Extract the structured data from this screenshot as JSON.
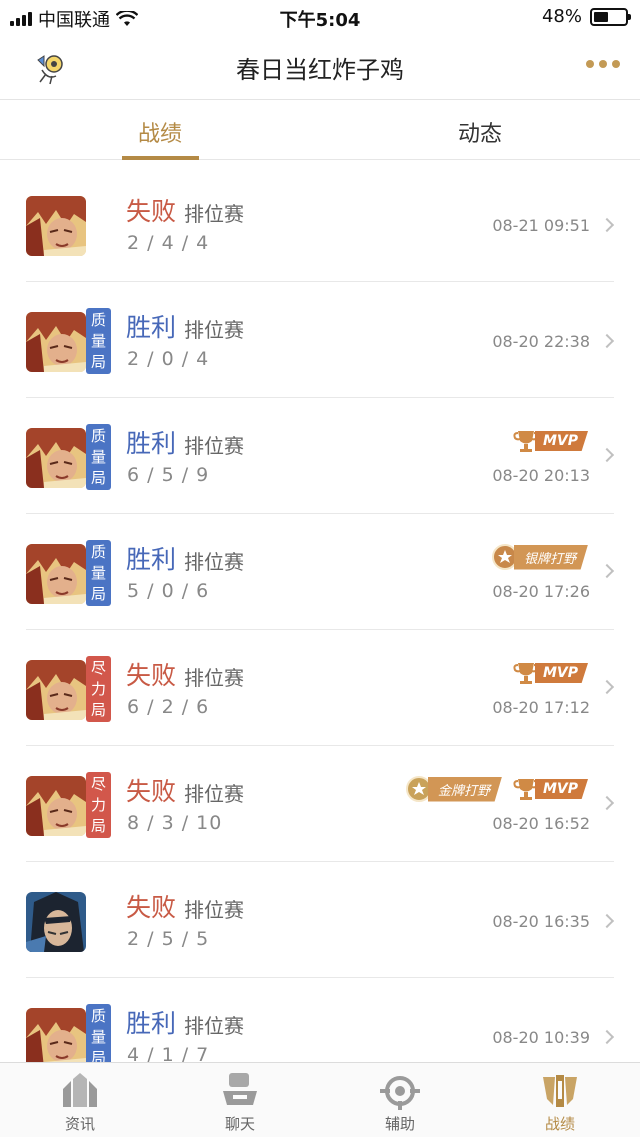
{
  "status_bar": {
    "carrier": "中国联通",
    "time": "下午5:04",
    "battery": "48%",
    "battery_level": 0.48
  },
  "header": {
    "title": "春日当红炸子鸡",
    "avatar_icon": "avatar-icon",
    "more_icon": "more-icon"
  },
  "tabs": [
    {
      "label": "战绩",
      "active": true
    },
    {
      "label": "动态",
      "active": false
    }
  ],
  "matches": [
    {
      "result": "失败",
      "mode": "排位赛",
      "kda": "2 / 4 / 4",
      "time": "08-21 09:51",
      "tag": "",
      "tag_color": "",
      "badges": [],
      "hero": "red-hair"
    },
    {
      "result": "胜利",
      "mode": "排位赛",
      "kda": "2 / 0 / 4",
      "time": "08-20 22:38",
      "tag": "质量局",
      "tag_color": "blue",
      "badges": [],
      "hero": "red-hair"
    },
    {
      "result": "胜利",
      "mode": "排位赛",
      "kda": "6 / 5 / 9",
      "time": "08-20 20:13",
      "tag": "质量局",
      "tag_color": "blue",
      "badges": [
        "MVP"
      ],
      "hero": "red-hair"
    },
    {
      "result": "胜利",
      "mode": "排位赛",
      "kda": "5 / 0 / 6",
      "time": "08-20 17:26",
      "tag": "质量局",
      "tag_color": "blue",
      "badges": [
        "银牌打野"
      ],
      "hero": "red-hair"
    },
    {
      "result": "失败",
      "mode": "排位赛",
      "kda": "6 / 2 / 6",
      "time": "08-20 17:12",
      "tag": "尽力局",
      "tag_color": "red",
      "badges": [
        "MVP"
      ],
      "hero": "red-hair"
    },
    {
      "result": "失败",
      "mode": "排位赛",
      "kda": "8 / 3 / 10",
      "time": "08-20 16:52",
      "tag": "尽力局",
      "tag_color": "red",
      "badges": [
        "金牌打野",
        "MVP"
      ],
      "hero": "red-hair"
    },
    {
      "result": "失败",
      "mode": "排位赛",
      "kda": "2 / 5 / 5",
      "time": "08-20 16:35",
      "tag": "",
      "tag_color": "",
      "badges": [],
      "hero": "dark-hair"
    },
    {
      "result": "胜利",
      "mode": "排位赛",
      "kda": "4 / 1 / 7",
      "time": "08-20 10:39",
      "tag": "质量局",
      "tag_color": "blue",
      "badges": [],
      "hero": "red-hair"
    }
  ],
  "bottom_nav": [
    {
      "label": "资讯",
      "icon": "news-icon",
      "active": false
    },
    {
      "label": "聊天",
      "icon": "chat-icon",
      "active": false
    },
    {
      "label": "辅助",
      "icon": "assist-icon",
      "active": false
    },
    {
      "label": "战绩",
      "icon": "record-icon",
      "active": true
    }
  ],
  "colors": {
    "accent": "#b48a45",
    "win": "#4768b8",
    "lose": "#c85a45",
    "tag_blue": "#4b74c4",
    "tag_red": "#d2574b"
  }
}
